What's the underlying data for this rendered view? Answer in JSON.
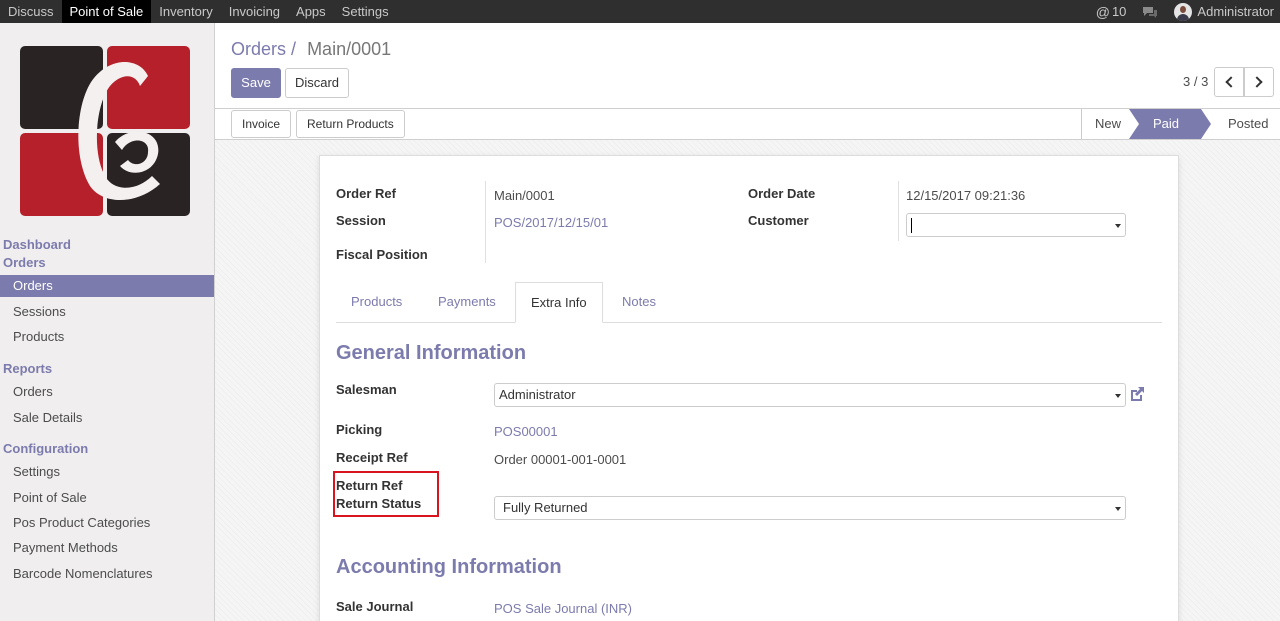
{
  "topbar": {
    "menu": [
      "Discuss",
      "Point of Sale",
      "Inventory",
      "Invoicing",
      "Apps",
      "Settings"
    ],
    "active_index": 1,
    "message_count": "10",
    "user": "Administrator"
  },
  "sidebar": {
    "dashboard": "Dashboard",
    "orders_section": "Orders",
    "orders_items": [
      "Orders",
      "Sessions",
      "Products"
    ],
    "reports_section": "Reports",
    "reports_items": [
      "Orders",
      "Sale Details"
    ],
    "config_section": "Configuration",
    "config_items": [
      "Settings",
      "Point of Sale",
      "Pos Product Categories",
      "Payment Methods",
      "Barcode Nomenclatures"
    ]
  },
  "control_panel": {
    "breadcrumb_parent": "Orders",
    "breadcrumb_sep": "/",
    "breadcrumb_current": "Main/0001",
    "save_label": "Save",
    "discard_label": "Discard",
    "pager": "3 / 3"
  },
  "statusbar": {
    "invoice_label": "Invoice",
    "return_products_label": "Return Products",
    "stages": [
      "New",
      "Paid",
      "Posted"
    ],
    "current_stage": "Paid"
  },
  "form": {
    "order_ref_label": "Order Ref",
    "order_ref": "Main/0001",
    "session_label": "Session",
    "session": "POS/2017/12/15/01",
    "fiscal_position_label": "Fiscal Position",
    "order_date_label": "Order Date",
    "order_date": "12/15/2017 09:21:36",
    "customer_label": "Customer",
    "customer": "",
    "tabs": [
      "Products",
      "Payments",
      "Extra Info",
      "Notes"
    ],
    "active_tab": "Extra Info",
    "general_title": "General Information",
    "salesman_label": "Salesman",
    "salesman": "Administrator",
    "picking_label": "Picking",
    "picking": "POS00001",
    "receipt_ref_label": "Receipt Ref",
    "receipt_ref": "Order 00001-001-0001",
    "return_ref_label": "Return Ref",
    "return_status_label": "Return Status",
    "return_status": "Fully Returned",
    "accounting_title": "Accounting Information",
    "sale_journal_label": "Sale Journal",
    "sale_journal": "POS Sale Journal (INR)"
  },
  "colors": {
    "accent": "#7c7bad",
    "topbar": "#2f2f2f",
    "highlight": "#d9141e",
    "logo_red": "#b5202a",
    "logo_dark": "#2a2324"
  }
}
